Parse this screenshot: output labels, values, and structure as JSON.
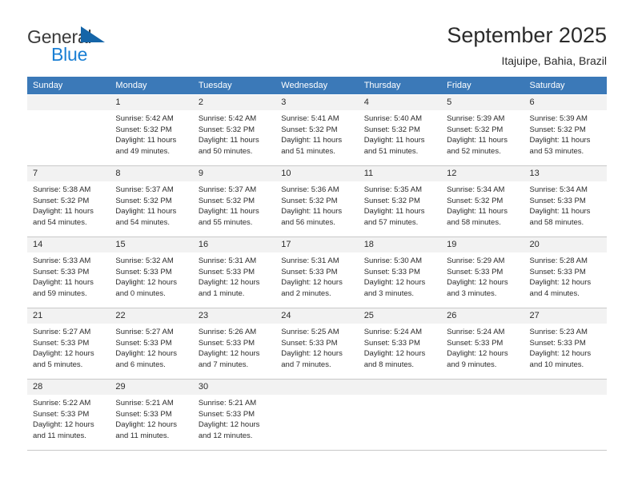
{
  "brand": {
    "name_part1": "General",
    "name_part2": "Blue",
    "triangle_color": "#1565a8",
    "blue_text_color": "#1a7fd4"
  },
  "header": {
    "title": "September 2025",
    "subtitle": "Itajuipe, Bahia, Brazil"
  },
  "theme": {
    "header_row_bg": "#3b79b8",
    "header_row_text": "#ffffff",
    "daynum_bg": "#f2f2f2",
    "cell_border": "#c8c8c8"
  },
  "weekdays": [
    "Sunday",
    "Monday",
    "Tuesday",
    "Wednesday",
    "Thursday",
    "Friday",
    "Saturday"
  ],
  "weeks": [
    [
      {
        "day": "",
        "sunrise": "",
        "sunset": "",
        "daylight_line1": "",
        "daylight_line2": "",
        "empty": true
      },
      {
        "day": "1",
        "sunrise": "Sunrise: 5:42 AM",
        "sunset": "Sunset: 5:32 PM",
        "daylight_line1": "Daylight: 11 hours",
        "daylight_line2": "and 49 minutes.",
        "empty": false
      },
      {
        "day": "2",
        "sunrise": "Sunrise: 5:42 AM",
        "sunset": "Sunset: 5:32 PM",
        "daylight_line1": "Daylight: 11 hours",
        "daylight_line2": "and 50 minutes.",
        "empty": false
      },
      {
        "day": "3",
        "sunrise": "Sunrise: 5:41 AM",
        "sunset": "Sunset: 5:32 PM",
        "daylight_line1": "Daylight: 11 hours",
        "daylight_line2": "and 51 minutes.",
        "empty": false
      },
      {
        "day": "4",
        "sunrise": "Sunrise: 5:40 AM",
        "sunset": "Sunset: 5:32 PM",
        "daylight_line1": "Daylight: 11 hours",
        "daylight_line2": "and 51 minutes.",
        "empty": false
      },
      {
        "day": "5",
        "sunrise": "Sunrise: 5:39 AM",
        "sunset": "Sunset: 5:32 PM",
        "daylight_line1": "Daylight: 11 hours",
        "daylight_line2": "and 52 minutes.",
        "empty": false
      },
      {
        "day": "6",
        "sunrise": "Sunrise: 5:39 AM",
        "sunset": "Sunset: 5:32 PM",
        "daylight_line1": "Daylight: 11 hours",
        "daylight_line2": "and 53 minutes.",
        "empty": false
      }
    ],
    [
      {
        "day": "7",
        "sunrise": "Sunrise: 5:38 AM",
        "sunset": "Sunset: 5:32 PM",
        "daylight_line1": "Daylight: 11 hours",
        "daylight_line2": "and 54 minutes.",
        "empty": false
      },
      {
        "day": "8",
        "sunrise": "Sunrise: 5:37 AM",
        "sunset": "Sunset: 5:32 PM",
        "daylight_line1": "Daylight: 11 hours",
        "daylight_line2": "and 54 minutes.",
        "empty": false
      },
      {
        "day": "9",
        "sunrise": "Sunrise: 5:37 AM",
        "sunset": "Sunset: 5:32 PM",
        "daylight_line1": "Daylight: 11 hours",
        "daylight_line2": "and 55 minutes.",
        "empty": false
      },
      {
        "day": "10",
        "sunrise": "Sunrise: 5:36 AM",
        "sunset": "Sunset: 5:32 PM",
        "daylight_line1": "Daylight: 11 hours",
        "daylight_line2": "and 56 minutes.",
        "empty": false
      },
      {
        "day": "11",
        "sunrise": "Sunrise: 5:35 AM",
        "sunset": "Sunset: 5:32 PM",
        "daylight_line1": "Daylight: 11 hours",
        "daylight_line2": "and 57 minutes.",
        "empty": false
      },
      {
        "day": "12",
        "sunrise": "Sunrise: 5:34 AM",
        "sunset": "Sunset: 5:32 PM",
        "daylight_line1": "Daylight: 11 hours",
        "daylight_line2": "and 58 minutes.",
        "empty": false
      },
      {
        "day": "13",
        "sunrise": "Sunrise: 5:34 AM",
        "sunset": "Sunset: 5:33 PM",
        "daylight_line1": "Daylight: 11 hours",
        "daylight_line2": "and 58 minutes.",
        "empty": false
      }
    ],
    [
      {
        "day": "14",
        "sunrise": "Sunrise: 5:33 AM",
        "sunset": "Sunset: 5:33 PM",
        "daylight_line1": "Daylight: 11 hours",
        "daylight_line2": "and 59 minutes.",
        "empty": false
      },
      {
        "day": "15",
        "sunrise": "Sunrise: 5:32 AM",
        "sunset": "Sunset: 5:33 PM",
        "daylight_line1": "Daylight: 12 hours",
        "daylight_line2": "and 0 minutes.",
        "empty": false
      },
      {
        "day": "16",
        "sunrise": "Sunrise: 5:31 AM",
        "sunset": "Sunset: 5:33 PM",
        "daylight_line1": "Daylight: 12 hours",
        "daylight_line2": "and 1 minute.",
        "empty": false
      },
      {
        "day": "17",
        "sunrise": "Sunrise: 5:31 AM",
        "sunset": "Sunset: 5:33 PM",
        "daylight_line1": "Daylight: 12 hours",
        "daylight_line2": "and 2 minutes.",
        "empty": false
      },
      {
        "day": "18",
        "sunrise": "Sunrise: 5:30 AM",
        "sunset": "Sunset: 5:33 PM",
        "daylight_line1": "Daylight: 12 hours",
        "daylight_line2": "and 3 minutes.",
        "empty": false
      },
      {
        "day": "19",
        "sunrise": "Sunrise: 5:29 AM",
        "sunset": "Sunset: 5:33 PM",
        "daylight_line1": "Daylight: 12 hours",
        "daylight_line2": "and 3 minutes.",
        "empty": false
      },
      {
        "day": "20",
        "sunrise": "Sunrise: 5:28 AM",
        "sunset": "Sunset: 5:33 PM",
        "daylight_line1": "Daylight: 12 hours",
        "daylight_line2": "and 4 minutes.",
        "empty": false
      }
    ],
    [
      {
        "day": "21",
        "sunrise": "Sunrise: 5:27 AM",
        "sunset": "Sunset: 5:33 PM",
        "daylight_line1": "Daylight: 12 hours",
        "daylight_line2": "and 5 minutes.",
        "empty": false
      },
      {
        "day": "22",
        "sunrise": "Sunrise: 5:27 AM",
        "sunset": "Sunset: 5:33 PM",
        "daylight_line1": "Daylight: 12 hours",
        "daylight_line2": "and 6 minutes.",
        "empty": false
      },
      {
        "day": "23",
        "sunrise": "Sunrise: 5:26 AM",
        "sunset": "Sunset: 5:33 PM",
        "daylight_line1": "Daylight: 12 hours",
        "daylight_line2": "and 7 minutes.",
        "empty": false
      },
      {
        "day": "24",
        "sunrise": "Sunrise: 5:25 AM",
        "sunset": "Sunset: 5:33 PM",
        "daylight_line1": "Daylight: 12 hours",
        "daylight_line2": "and 7 minutes.",
        "empty": false
      },
      {
        "day": "25",
        "sunrise": "Sunrise: 5:24 AM",
        "sunset": "Sunset: 5:33 PM",
        "daylight_line1": "Daylight: 12 hours",
        "daylight_line2": "and 8 minutes.",
        "empty": false
      },
      {
        "day": "26",
        "sunrise": "Sunrise: 5:24 AM",
        "sunset": "Sunset: 5:33 PM",
        "daylight_line1": "Daylight: 12 hours",
        "daylight_line2": "and 9 minutes.",
        "empty": false
      },
      {
        "day": "27",
        "sunrise": "Sunrise: 5:23 AM",
        "sunset": "Sunset: 5:33 PM",
        "daylight_line1": "Daylight: 12 hours",
        "daylight_line2": "and 10 minutes.",
        "empty": false
      }
    ],
    [
      {
        "day": "28",
        "sunrise": "Sunrise: 5:22 AM",
        "sunset": "Sunset: 5:33 PM",
        "daylight_line1": "Daylight: 12 hours",
        "daylight_line2": "and 11 minutes.",
        "empty": false
      },
      {
        "day": "29",
        "sunrise": "Sunrise: 5:21 AM",
        "sunset": "Sunset: 5:33 PM",
        "daylight_line1": "Daylight: 12 hours",
        "daylight_line2": "and 11 minutes.",
        "empty": false
      },
      {
        "day": "30",
        "sunrise": "Sunrise: 5:21 AM",
        "sunset": "Sunset: 5:33 PM",
        "daylight_line1": "Daylight: 12 hours",
        "daylight_line2": "and 12 minutes.",
        "empty": false
      },
      {
        "day": "",
        "sunrise": "",
        "sunset": "",
        "daylight_line1": "",
        "daylight_line2": "",
        "empty": true
      },
      {
        "day": "",
        "sunrise": "",
        "sunset": "",
        "daylight_line1": "",
        "daylight_line2": "",
        "empty": true
      },
      {
        "day": "",
        "sunrise": "",
        "sunset": "",
        "daylight_line1": "",
        "daylight_line2": "",
        "empty": true
      },
      {
        "day": "",
        "sunrise": "",
        "sunset": "",
        "daylight_line1": "",
        "daylight_line2": "",
        "empty": true
      }
    ]
  ]
}
